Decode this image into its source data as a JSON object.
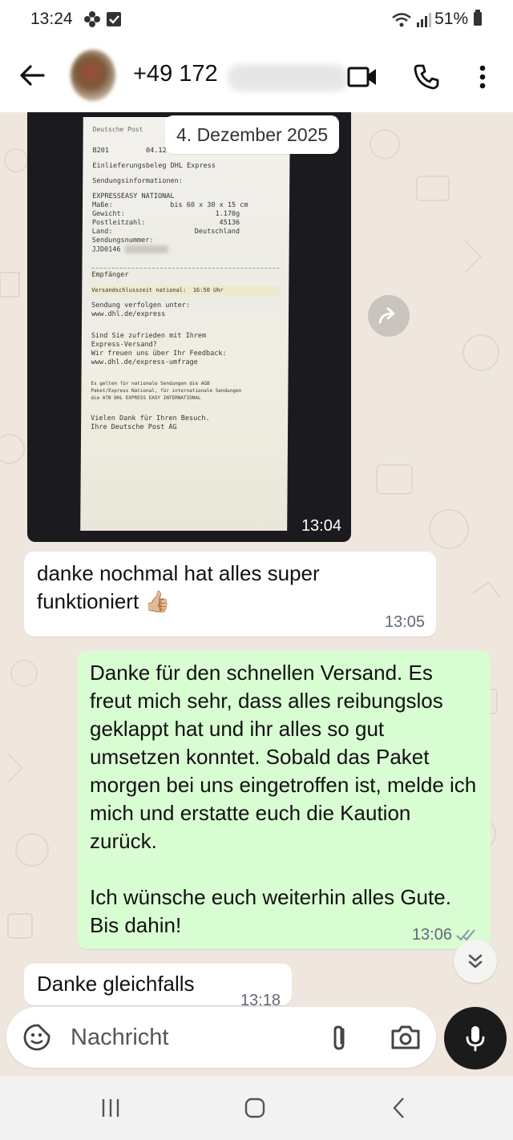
{
  "status_bar": {
    "time": "13:24",
    "battery": "51%",
    "icons": [
      "flower-icon",
      "check-box-icon",
      "wifi-icon",
      "signal-icon",
      "battery-icon"
    ]
  },
  "header": {
    "contact_name": "+49 172",
    "icons": [
      "back-arrow-icon",
      "video-call-icon",
      "voice-call-icon",
      "more-options-icon"
    ]
  },
  "date_chip": "4. Dezember 2025",
  "image_message": {
    "time": "13:04",
    "receipt_lines": [
      "Deutsche Post",
      "B201         04.12.2025   12:02",
      "Einlieferungsbeleg DHL Express",
      "Sendungsinformationen:",
      "EXPRESSEASY NATIONAL",
      "Maße:              bis 60 x 30 x 15 cm",
      "Gewicht:                      1.170g",
      "Postleitzahl:                  45136",
      "Land:                    Deutschland",
      "Sendungsnummer:",
      "JJD0146",
      "Empfänger",
      "Versandschlusszeit national:  16:50 Uhr",
      "Sendung verfolgen unter:",
      "www.dhl.de/express",
      "Sind Sie zufrieden mit Ihrem",
      "Express-Versand?",
      "Wir freuen uns über Ihr Feedback:",
      "www.dhl.de/express-umfrage",
      "Es gelten für nationale Sendungen die AGB",
      "Paket/Express National, für internationale Sendungen",
      "die ATB DHL EXPRESS EASY INTERNATIONAL",
      "Vielen Dank für Ihren Besuch.",
      "Ihre Deutsche Post AG"
    ]
  },
  "messages": [
    {
      "direction": "in",
      "text": "danke nochmal hat alles super funktioniert 👍🏼",
      "time": "13:05"
    },
    {
      "direction": "out",
      "text": "Danke für den schnellen Versand. Es freut mich sehr, dass alles reibungslos geklappt hat und ihr alles so gut umsetzen konntet. Sobald das Paket morgen bei uns eingetroffen ist, melde ich mich und erstatte euch die Kaution zurück.\n\nIch wünsche euch weiterhin alles Gute. Bis dahin!",
      "time": "13:06",
      "status": "read"
    },
    {
      "direction": "in",
      "text": "Danke gleichfalls",
      "time": "13:18"
    }
  ],
  "composer": {
    "placeholder": "Nachricht",
    "icons": [
      "sticker-icon",
      "attach-icon",
      "camera-icon",
      "mic-icon"
    ]
  },
  "nav": [
    "recent-apps-icon",
    "home-icon",
    "back-icon"
  ]
}
